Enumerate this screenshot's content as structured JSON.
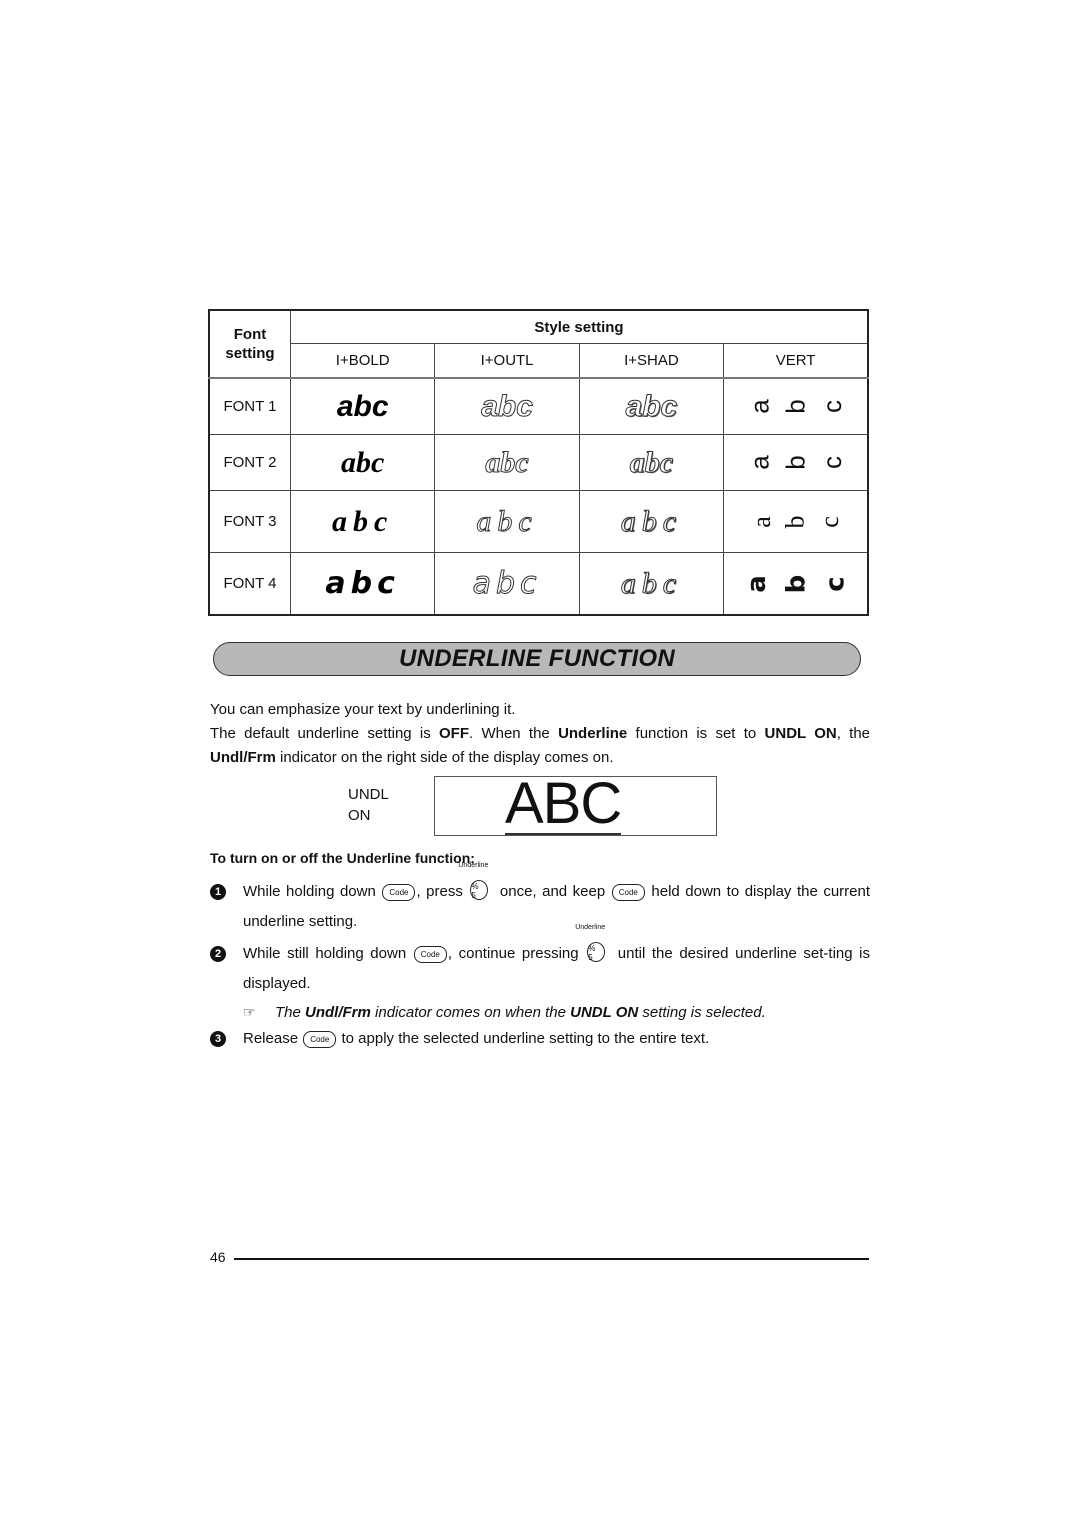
{
  "style_table": {
    "font_header": "Font setting",
    "style_header": "Style setting",
    "columns": [
      "I+BOLD",
      "I+OUTL",
      "I+SHAD",
      "VERT"
    ],
    "rows": [
      {
        "font": "FONT 1",
        "sample": "abc",
        "vert": [
          "a",
          "b",
          "c"
        ]
      },
      {
        "font": "FONT 2",
        "sample": "abc",
        "vert": [
          "a",
          "b",
          "c"
        ]
      },
      {
        "font": "FONT 3",
        "sample": "abc",
        "vert": [
          "a",
          "b",
          "c"
        ]
      },
      {
        "font": "FONT 4",
        "sample": "abc",
        "vert": [
          "a",
          "b",
          "c"
        ]
      }
    ]
  },
  "section_title": "UNDERLINE FUNCTION",
  "intro": {
    "line1": "You can emphasize your text by underlining it.",
    "p2_a": "The default underline setting is ",
    "p2_b": "OFF",
    "p2_c": ". When the ",
    "p2_d": "Underline",
    "p2_e": " function is set to ",
    "p2_f": "UNDL ON",
    "p2_g": ", the ",
    "p2_h": "Undl/Frm",
    "p2_i": " indicator on the right side of the display comes on."
  },
  "display": {
    "label_line1": "UNDL",
    "label_line2": "ON",
    "text": "ABC"
  },
  "procedure": {
    "heading": "To turn on or off the Underline function:",
    "keys": {
      "code": "Code",
      "five_top": "%",
      "five_bottom": "5",
      "five_caption": "Underline"
    },
    "step1": {
      "num": "1",
      "a": "While holding down ",
      "b": ", press ",
      "c": " once, and keep ",
      "d": " held down to display the current underline setting."
    },
    "step2": {
      "num": "2",
      "a": "While still holding down ",
      "b": ", continue pressing ",
      "c": " until the desired underline set-ting is displayed."
    },
    "note": {
      "icon": "☞",
      "a": "The ",
      "b": "Undl/Frm",
      "c": " indicator comes on when the ",
      "d": "UNDL ON",
      "e": " setting is selected."
    },
    "step3": {
      "num": "3",
      "a": "Release ",
      "b": " to apply the selected underline setting to the entire text."
    }
  },
  "footer": {
    "page_number": "46"
  }
}
